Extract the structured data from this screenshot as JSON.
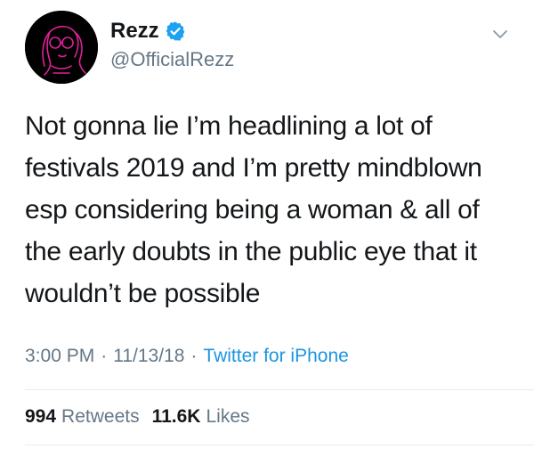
{
  "author": {
    "display_name": "Rezz",
    "handle": "@OfficialRezz",
    "verified_icon": "verified-badge-icon",
    "avatar_icon": "rezz-avatar-illustration"
  },
  "menu": {
    "icon": "chevron-down-icon"
  },
  "tweet": {
    "text": "Not gonna lie I’m headlining a lot of\nfestivals 2019 and I’m pretty mindblown\nesp considering being a woman & all of\nthe early doubts in the public eye that it\nwouldn’t be possible"
  },
  "meta": {
    "time": "3:00 PM",
    "separator": "·",
    "date": "11/13/18",
    "source": "Twitter for iPhone"
  },
  "stats": {
    "retweets_count": "994",
    "retweets_label": "Retweets",
    "likes_count": "11.6K",
    "likes_label": "Likes"
  },
  "colors": {
    "text": "#14171a",
    "secondary": "#657786",
    "link": "#1b95e0",
    "verified": "#1da1f2",
    "avatar_bg": "#000000",
    "avatar_line": "#e0209a",
    "divider": "#e6ecf0"
  }
}
